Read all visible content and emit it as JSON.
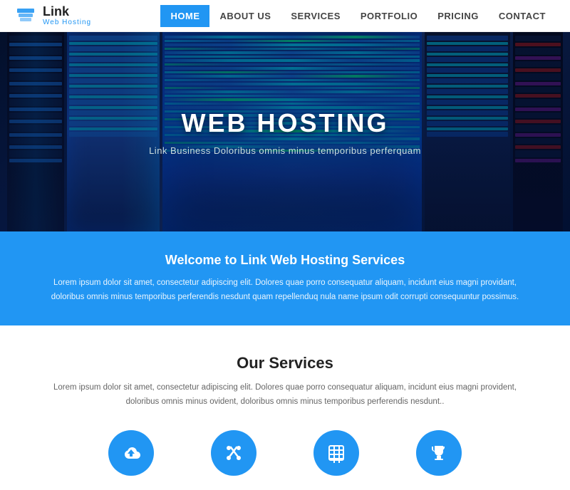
{
  "header": {
    "logo_link": "Link",
    "logo_sub": "Web Hosting",
    "nav": [
      {
        "label": "HOME",
        "active": true
      },
      {
        "label": "ABOUT US",
        "active": false
      },
      {
        "label": "SERVICES",
        "active": false
      },
      {
        "label": "PORTFOLIO",
        "active": false
      },
      {
        "label": "PRICING",
        "active": false
      },
      {
        "label": "CONTACT",
        "active": false
      }
    ]
  },
  "hero": {
    "title": "WEB HOSTING",
    "subtitle": "Link Business Doloribus omnis minus temporibus perferquam"
  },
  "welcome": {
    "title": "Welcome to Link Web Hosting Services",
    "text": "Lorem ipsum dolor sit amet, consectetur adipiscing elit. Dolores quae porro consequatur aliquam, incidunt eius magni providant, doloribus omnis minus temporibus perferendis nesdunt quam repellenduq nula name ipsum odit corrupti consequuntur possimus."
  },
  "services": {
    "title": "Our Services",
    "text": "Lorem ipsum dolor sit amet, consectetur adipiscing elit. Dolores quae porro consequatur aliquam, incidunt eius magni provident, doloribus omnis minus ovident, doloribus omnis minus temporibus perferendis nesdunt..",
    "icons": [
      {
        "name": "cloud-upload-icon",
        "symbol": "☁"
      },
      {
        "name": "tools-icon",
        "symbol": "✂"
      },
      {
        "name": "table-icon",
        "symbol": "⊞"
      },
      {
        "name": "trophy-icon",
        "symbol": "🏆"
      }
    ]
  }
}
